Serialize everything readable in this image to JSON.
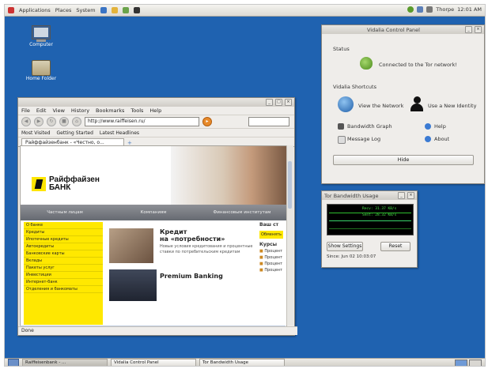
{
  "top_panel": {
    "menus": [
      "Applications",
      "Places",
      "System"
    ],
    "user": "Thorpe",
    "clock": "12:01 AM"
  },
  "desktop": {
    "icons": [
      {
        "label": "Computer"
      },
      {
        "label": "Home Folder"
      }
    ]
  },
  "browser": {
    "menu": [
      "File",
      "Edit",
      "View",
      "History",
      "Bookmarks",
      "Tools",
      "Help"
    ],
    "url": "http://www.raiffeisen.ru/",
    "bookmarks": [
      "Most Visited",
      "Getting Started",
      "Latest Headlines"
    ],
    "tab_title": "Райффайзенбанк - «Честно, о...",
    "status": "Done",
    "page": {
      "bank_name_line1": "Райффайзен",
      "bank_name_line2": "БАНК",
      "nav": [
        "Частным лицам",
        "Компаниям",
        "Финансовым институтам"
      ],
      "left_menu": [
        "О банке",
        "Кредиты",
        "Ипотечные кредиты",
        "Автокредиты",
        "Банковские карты",
        "Вклады",
        "Пакеты услуг",
        "Инвестиции",
        "Интернет-банк",
        "Отделения и банкоматы"
      ],
      "article_title_line1": "Кредит",
      "article_title_line2": "на «потребности»",
      "article_text": "Новые условия кредитования и процентные ставки по потребительским кредитам",
      "promo_title": "Premium Banking",
      "right_heading": "Ваш ст",
      "right_button": "Обменять",
      "right_sub": "Курсы",
      "right_items": [
        "Процент",
        "Процент",
        "Процент",
        "Процент"
      ]
    }
  },
  "vidalia": {
    "title": "Vidalia Control Panel",
    "status_heading": "Status",
    "status_text": "Connected to the Tor network!",
    "shortcuts_heading": "Vidalia Shortcuts",
    "view_network": "View the Network",
    "new_identity": "Use a New Identity",
    "bandwidth_graph": "Bandwidth Graph",
    "message_log": "Message Log",
    "help": "Help",
    "about": "About",
    "hide": "Hide"
  },
  "bandwidth": {
    "title": "Tor Bandwidth Usage",
    "recv_label": "Recv: 31.37 KB/s",
    "sent_label": "Sent: 28.32 KB/s",
    "show_settings": "Show Settings",
    "reset": "Reset",
    "since": "Since: Jun 02 10:03:07"
  },
  "taskbar": {
    "tasks": [
      "Raiffeisenbank - ...",
      "Vidalia Control Panel",
      "Tor Bandwidth Usage"
    ]
  },
  "colors": {
    "desktop": "#1f62b0",
    "title_active": "#3e6fb2",
    "bank_yellow": "#ffe800",
    "graph_green": "#2fbf2f"
  }
}
